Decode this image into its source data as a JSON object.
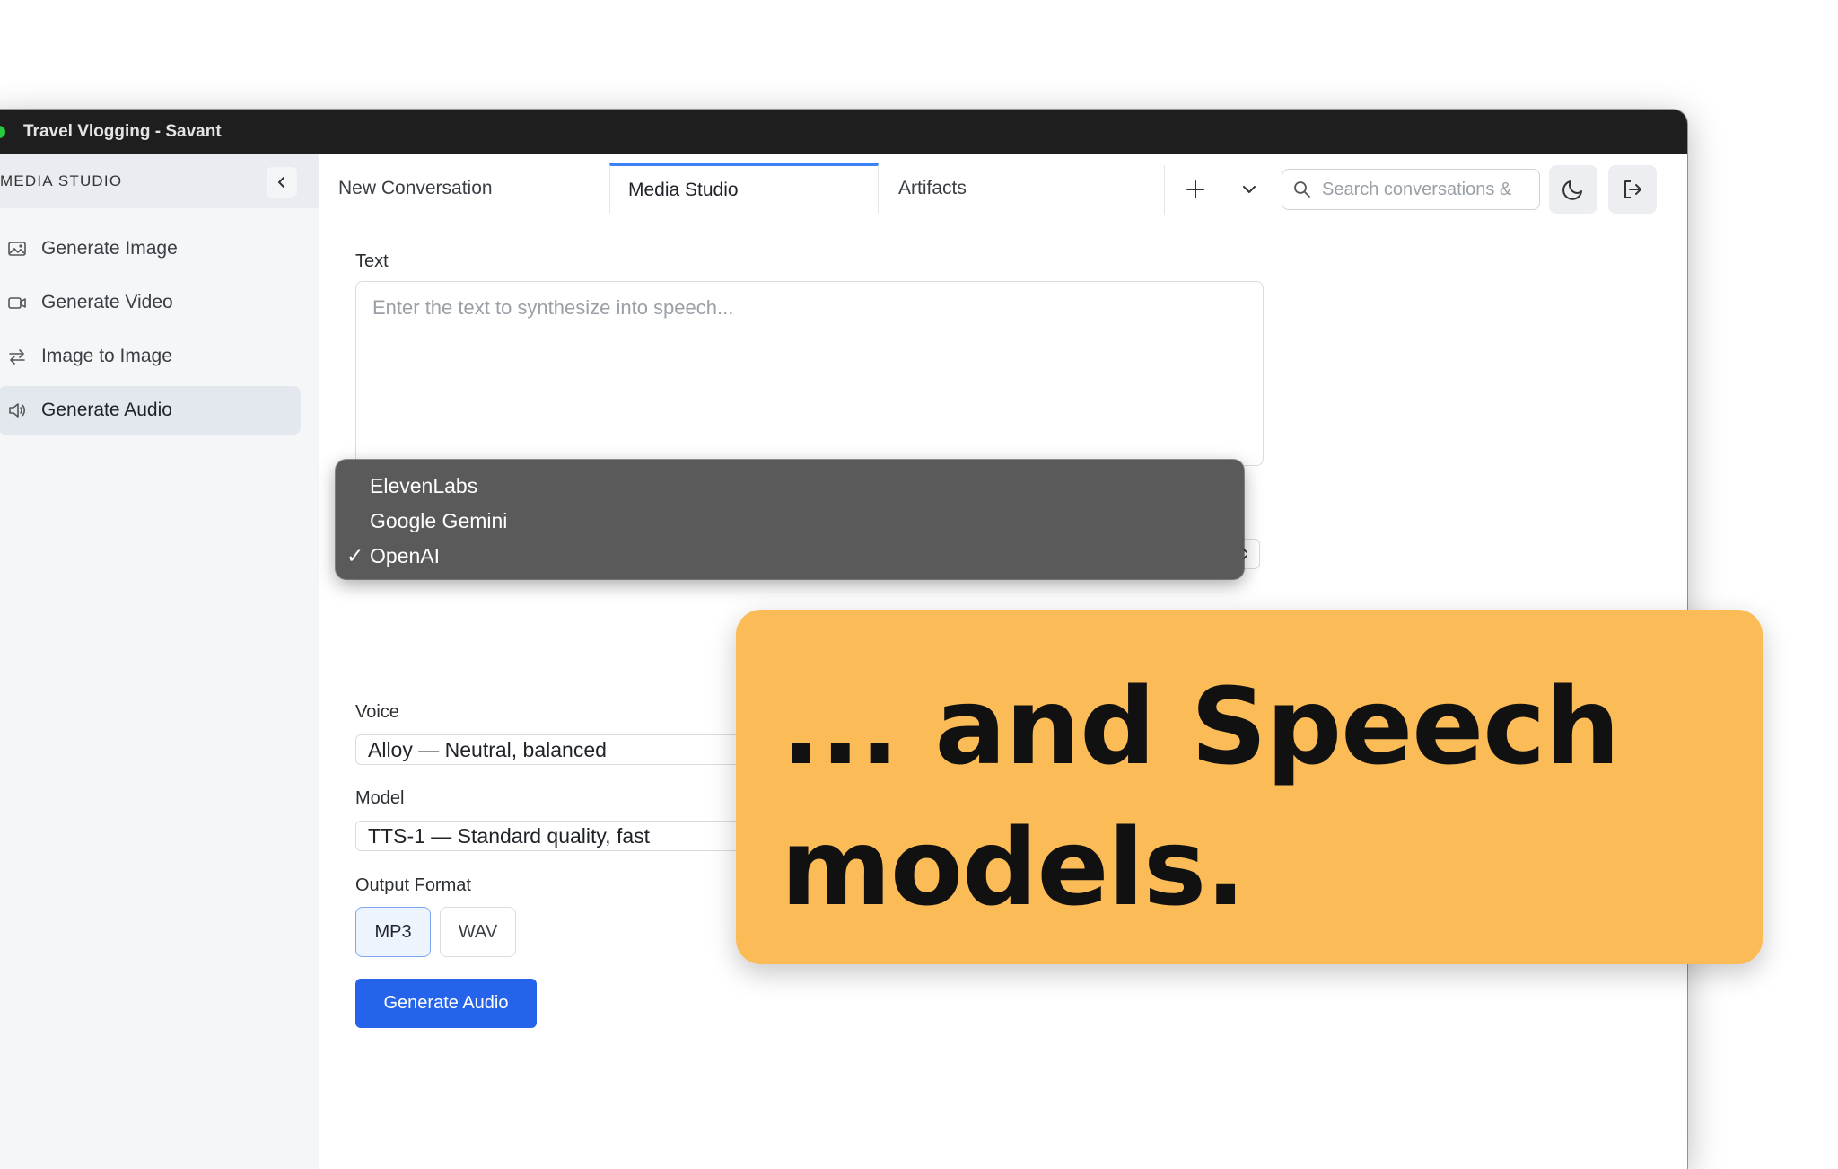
{
  "window": {
    "title": "Travel Vlogging - Savant"
  },
  "sidebar": {
    "title": "MEDIA STUDIO",
    "items": [
      {
        "label": "Generate Image",
        "icon": "image-icon",
        "active": false
      },
      {
        "label": "Generate Video",
        "icon": "video-icon",
        "active": false
      },
      {
        "label": "Image to Image",
        "icon": "swap-arrows-icon",
        "active": false
      },
      {
        "label": "Generate Audio",
        "icon": "speaker-icon",
        "active": true
      }
    ]
  },
  "tabs": [
    {
      "label": "New Conversation",
      "active": false
    },
    {
      "label": "Media Studio",
      "active": true
    },
    {
      "label": "Artifacts",
      "active": false
    }
  ],
  "search": {
    "placeholder": "Search conversations & "
  },
  "form": {
    "text_label": "Text",
    "text_placeholder": "Enter the text to synthesize into speech...",
    "provider_options": [
      {
        "label": "ElevenLabs",
        "checked": false
      },
      {
        "label": "Google Gemini",
        "checked": false
      },
      {
        "label": "OpenAI",
        "checked": true
      }
    ],
    "check_mark": "✓",
    "voice_label": "Voice",
    "voice_value": "Alloy — Neutral, balanced",
    "model_label": "Model",
    "model_value": "TTS-1 — Standard quality, fast",
    "output_format_label": "Output Format",
    "formats": [
      {
        "label": "MP3",
        "selected": true
      },
      {
        "label": "WAV",
        "selected": false
      }
    ],
    "submit_label": "Generate Audio"
  },
  "callout": {
    "text": "... and Speech models."
  },
  "colors": {
    "accent": "#2563eb",
    "callout_bg": "#fbbb56",
    "titlebar": "#1e1e1e",
    "tab_active_border": "#3b82f6"
  }
}
